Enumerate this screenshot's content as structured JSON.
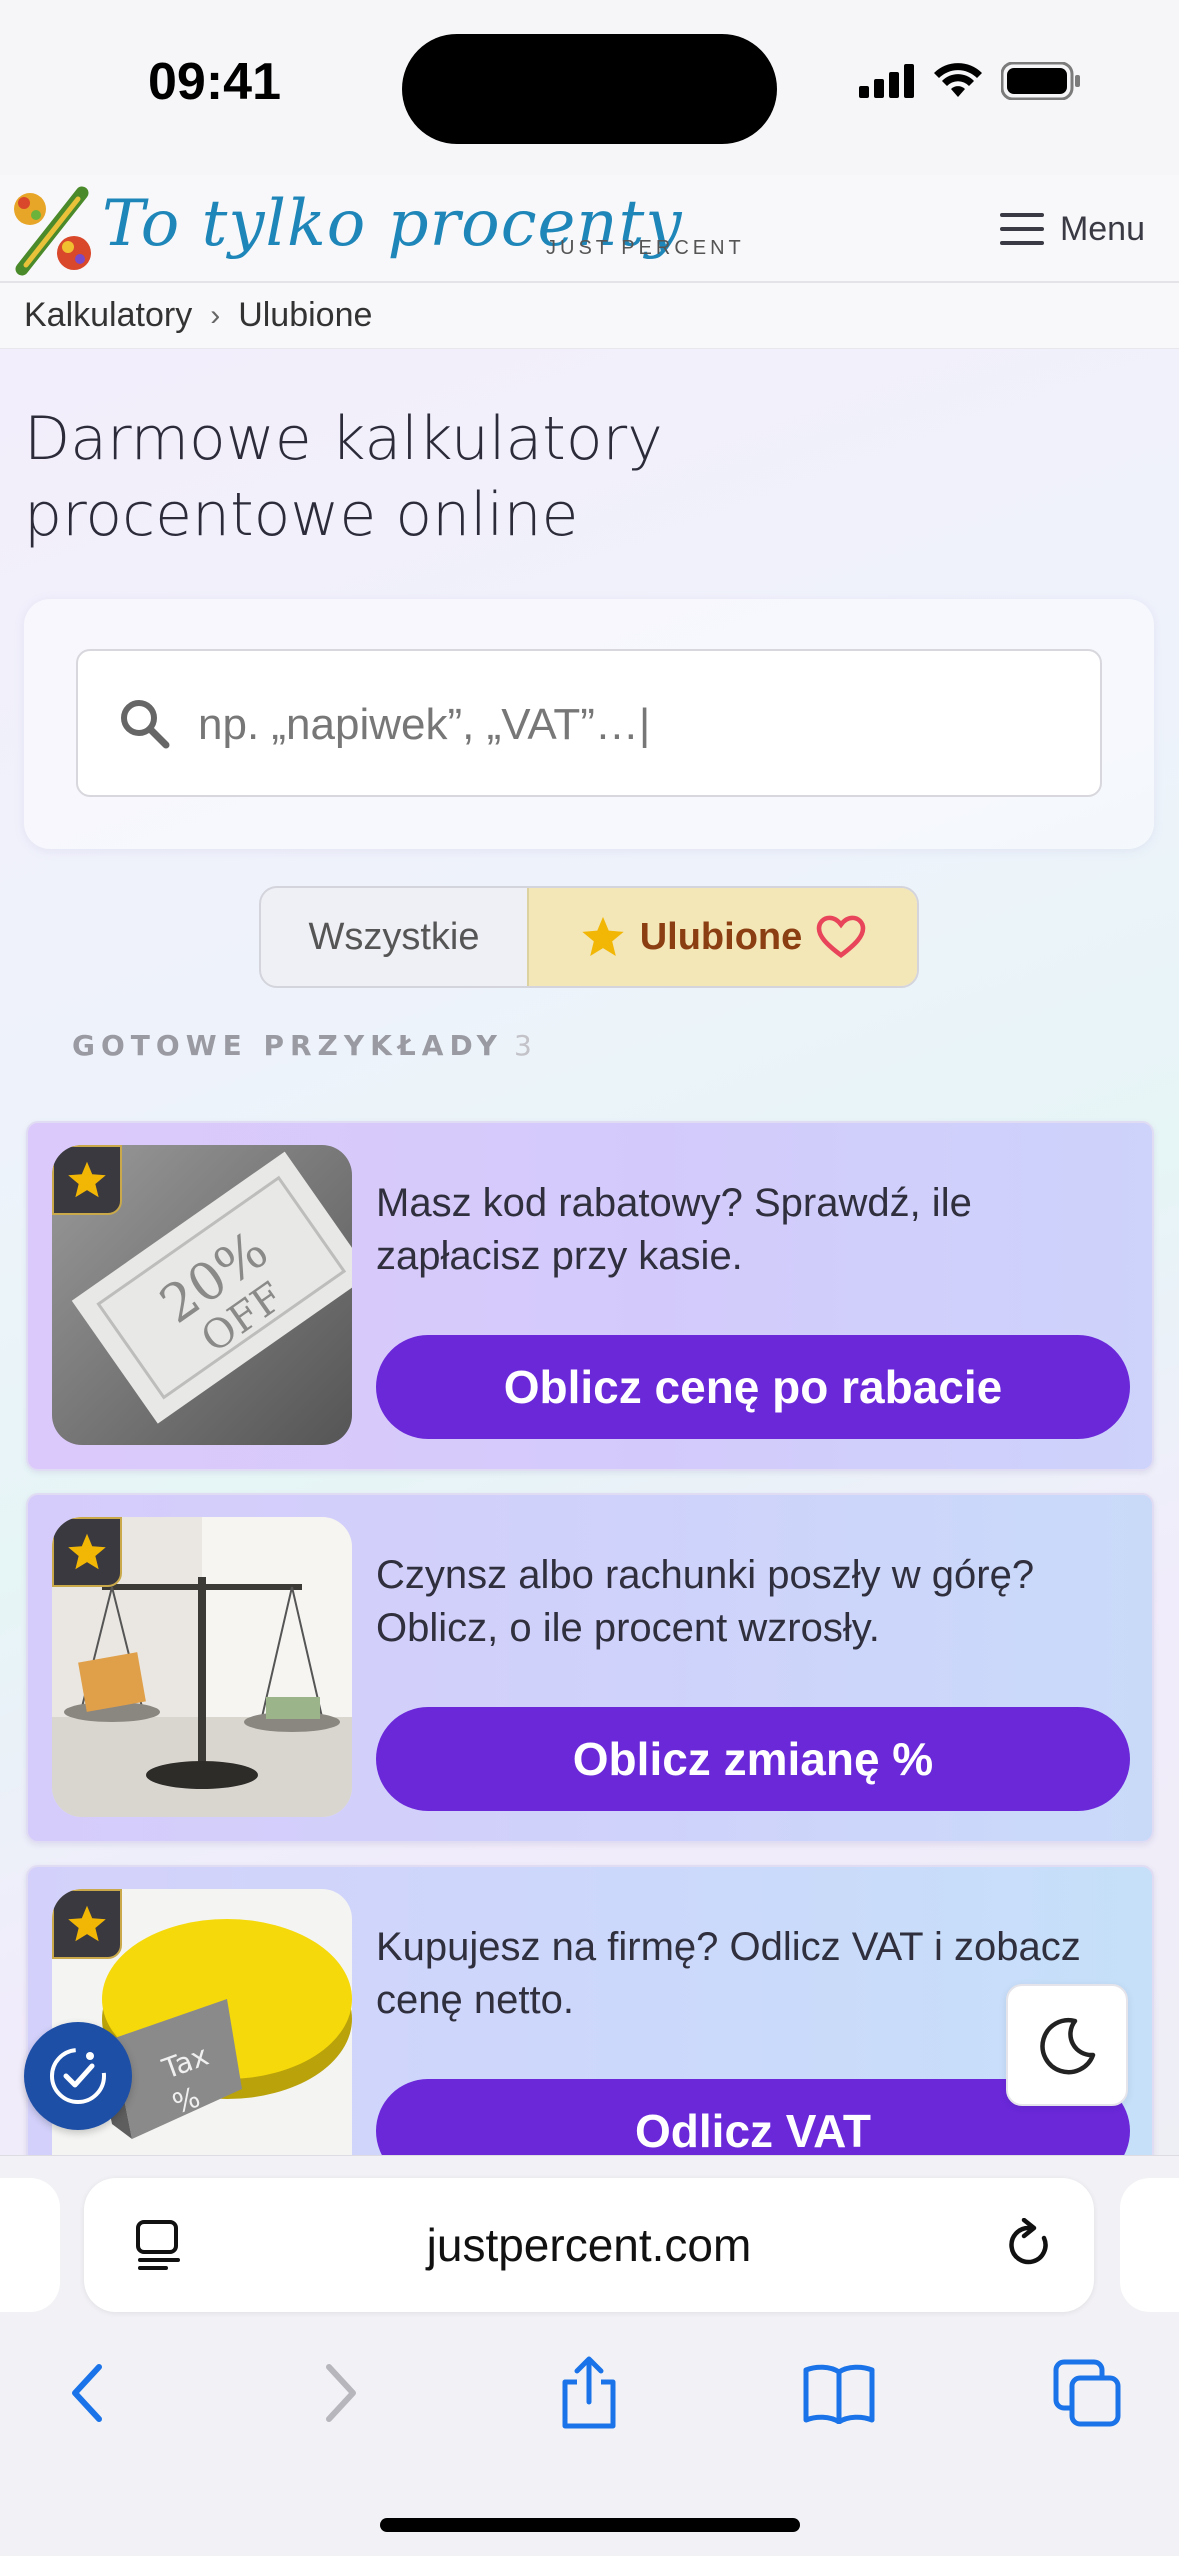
{
  "status_bar": {
    "time": "09:41"
  },
  "header": {
    "logo_title": "To tylko procenty",
    "logo_subtitle": "JUST PERCENT",
    "menu_label": "Menu"
  },
  "breadcrumb": {
    "items": [
      "Kalkulatory",
      "Ulubione"
    ],
    "separator": "›"
  },
  "page": {
    "title": "Darmowe kalkulatory procentowe online"
  },
  "search": {
    "placeholder": "np. „napiwek”, „VAT”…|"
  },
  "filter": {
    "all_label": "Wszystkie",
    "favorites_label": "Ulubione",
    "selected": "Ulubione"
  },
  "section": {
    "label": "GOTOWE PRZYKŁADY",
    "count": "3"
  },
  "cards": [
    {
      "description": "Masz kod rabatowy? Sprawdź, ile zapłacisz przy kasie.",
      "button_label": "Oblicz cenę po rabacie",
      "image_text_1": "20%",
      "image_text_2": "OFF"
    },
    {
      "description": "Czynsz albo rachunki poszły w górę? Oblicz, o ile procent wzrosły.",
      "button_label": "Oblicz zmianę %"
    },
    {
      "description": "Kupujesz na firmę? Odlicz VAT i zobacz cenę netto.",
      "button_label": "Odlicz VAT",
      "image_text_1": "Tax",
      "image_text_2": "%"
    }
  ],
  "browser": {
    "url": "justpercent.com"
  },
  "colors": {
    "accent": "#6a28d9",
    "logo_blue": "#1e86b8",
    "favorite_bg": "#f3e6b7",
    "star": "#f2b705"
  }
}
